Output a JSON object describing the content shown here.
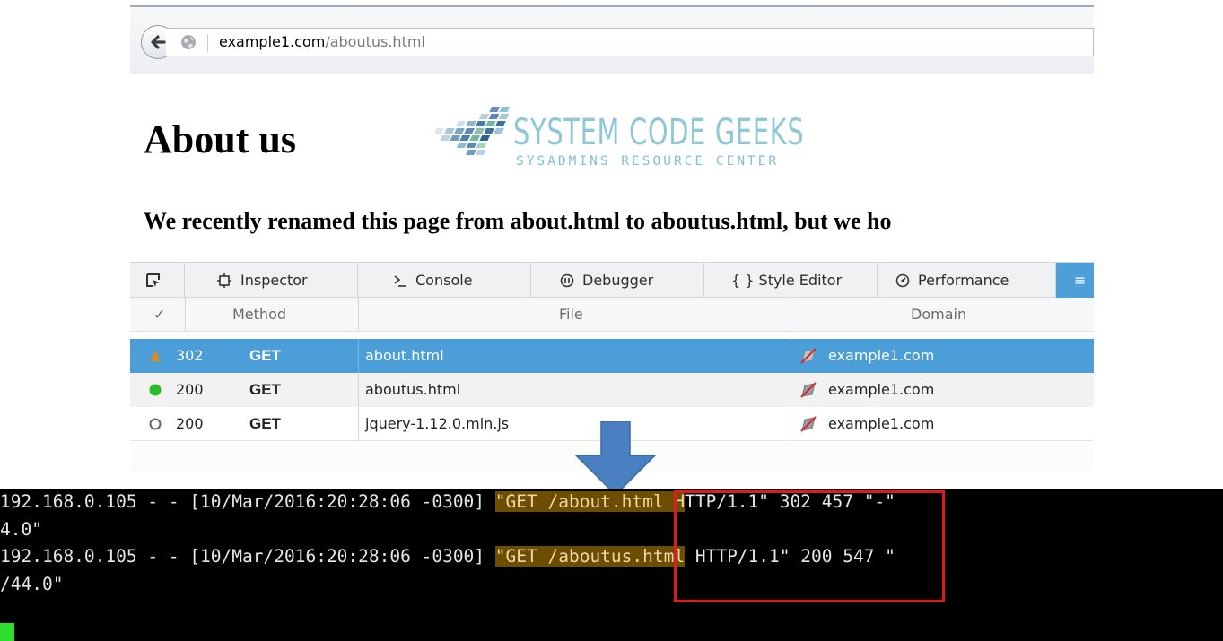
{
  "browser": {
    "url_domain": "example1.com",
    "url_path": "/aboutus.html"
  },
  "page": {
    "title": "About us",
    "logo_title": "SYSTEM CODE GEEKS",
    "logo_subtitle": "SYSADMINS RESOURCE CENTER",
    "subtitle": "We recently renamed this page from about.html to aboutus.html, but we ho"
  },
  "devtools": {
    "tabs": [
      {
        "label": "Inspector",
        "icon": "inspector-icon"
      },
      {
        "label": "Console",
        "icon": "console-icon"
      },
      {
        "label": "Debugger",
        "icon": "debugger-icon"
      },
      {
        "label": "{ } Style Editor",
        "icon": "style-editor-icon"
      },
      {
        "label": "Performance",
        "icon": "performance-icon"
      }
    ],
    "active_tab_label": "≡",
    "columns": {
      "check": "✓",
      "method": "Method",
      "file": "File",
      "domain": "Domain"
    },
    "requests": [
      {
        "status_icon": "warning-triangle",
        "status": "302",
        "method": "GET",
        "file": "about.html",
        "domain": "example1.com",
        "selected": true
      },
      {
        "status_icon": "green-circle",
        "status": "200",
        "method": "GET",
        "file": "aboutus.html",
        "domain": "example1.com",
        "selected": false
      },
      {
        "status_icon": "hollow-circle",
        "status": "200",
        "method": "GET",
        "file": "jquery-1.12.0.min.js",
        "domain": "example1.com",
        "selected": false
      }
    ]
  },
  "terminal": {
    "lines": [
      {
        "prefix": "192.168.0.105 - - [10/Mar/2016:20:28:06 -0300] ",
        "highlight": "\"GET /about.html H",
        "suffix": "TTP/1.1\" 302 457 \"-\""
      },
      {
        "prefix": "4.0\"",
        "highlight": "",
        "suffix": ""
      },
      {
        "prefix": "192.168.0.105 - - [10/Mar/2016:20:28:06 -0300] ",
        "highlight": "\"GET /aboutus.html",
        "suffix": " HTTP/1.1\" 200 547 \""
      },
      {
        "prefix": "/44.0\"",
        "highlight": "",
        "suffix": ""
      }
    ]
  },
  "colors": {
    "selected_row": "#4c9ed9",
    "terminal_bg": "#000000",
    "highlight_box": "#e11b1b",
    "highlight_fill": "#6d4d00",
    "cursor": "#2ee02e",
    "arrow": "#4a7fc1"
  }
}
